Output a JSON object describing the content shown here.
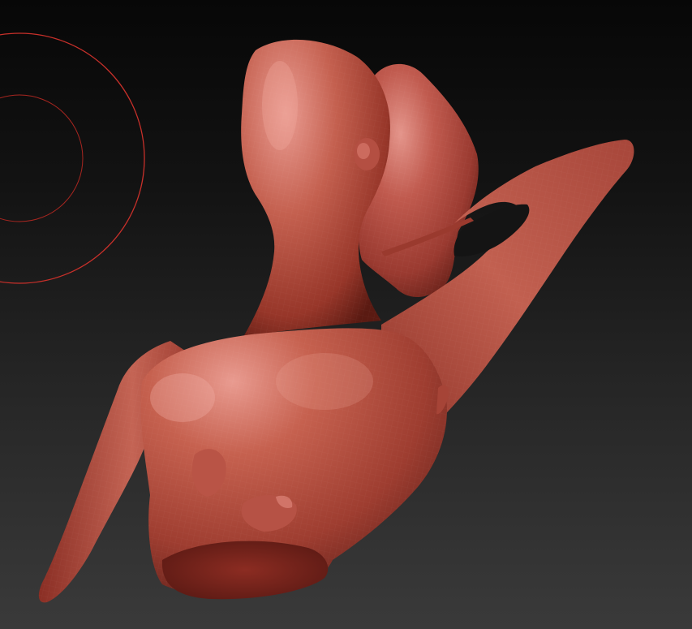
{
  "viewport": {
    "background_top": "#070707",
    "background_bottom": "#3a3a3a"
  },
  "brush_cursor": {
    "icon": "brush-radius-cursor-icon",
    "color": "#c8302a"
  },
  "model": {
    "icon": "sculpt-mesh-icon",
    "base_color": "#b0473d",
    "highlight_color": "#e8938a",
    "shadow_color": "#5a1a14"
  }
}
